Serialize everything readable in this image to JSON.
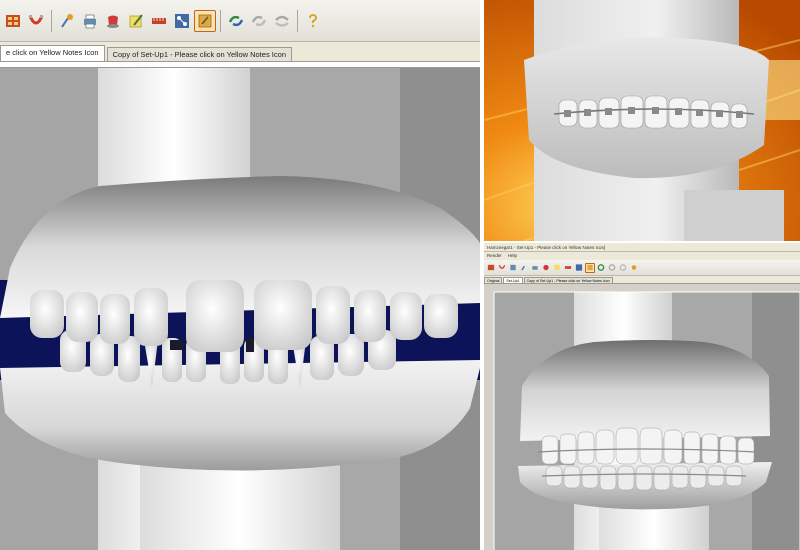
{
  "main_window": {
    "tabs": [
      {
        "label": "e click on Yellow Notes Icon",
        "active": true
      },
      {
        "label": "Copy of Set-Up1 - Please click on Yellow Notes Icon",
        "active": false
      }
    ],
    "toolbar_icons": [
      "grid-icon",
      "magnet-icon",
      "tooth-tool-icon",
      "printer-icon",
      "tooth-red-icon",
      "notes-pencil-icon",
      "ruler-icon",
      "bracket-icon",
      "yellow-notes-icon",
      "rotate-icon",
      "rotate-gray-icon",
      "rotate-gray-alt-icon",
      "help-icon"
    ],
    "active_toolbar_icon": "yellow-notes-icon",
    "colors": {
      "toolbar_bg": "#e2e0d8",
      "active_icon_border": "#c7621a",
      "scene_gray": "#9e9e9e",
      "scene_navy": "#0d1358",
      "model_white": "#ededed"
    }
  },
  "mini_window": {
    "title": "Hamzeegar1 - Set-Up1 - Please click on Yellow Notes Icon]",
    "menu": [
      "Render",
      "Help"
    ],
    "tabs": [
      {
        "label": "Original",
        "active": false
      },
      {
        "label": "Set-Up1",
        "active": true
      },
      {
        "label": "Copy of Set-Up1 - Please click on Yellow Notes Icon",
        "active": false
      }
    ]
  },
  "photo": {
    "colors": {
      "orange": "#e36f05",
      "glow": "#ffd25a"
    }
  }
}
